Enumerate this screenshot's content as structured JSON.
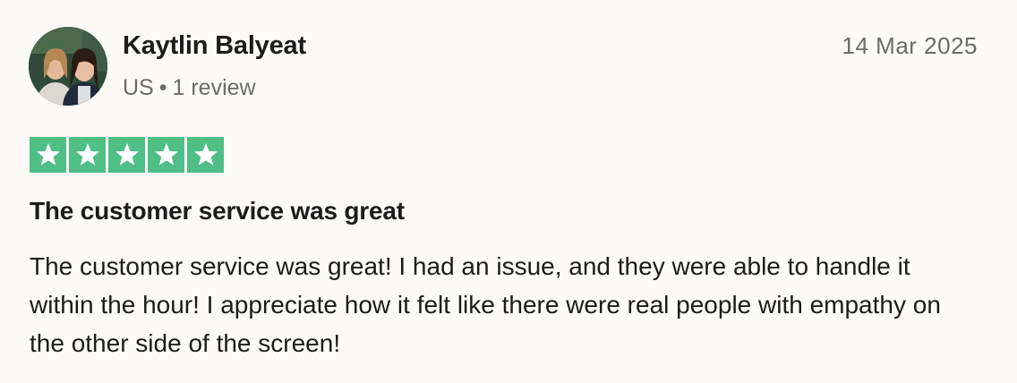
{
  "review": {
    "reviewer": {
      "name": "Kaytlin Balyeat",
      "country": "US",
      "separator": "•",
      "review_count": "1 review",
      "avatar_icon": "reviewer-photo"
    },
    "date": "14 Mar 2025",
    "rating": {
      "stars": 5,
      "max": 5,
      "star_color": "#4fbf86",
      "star_icon": "star-icon"
    },
    "title": "The customer service was great",
    "body": "The customer service was great! I had an issue, and they were able to handle it within the hour! I appreciate how it felt like there were real people with empathy on the other side of the screen!"
  }
}
